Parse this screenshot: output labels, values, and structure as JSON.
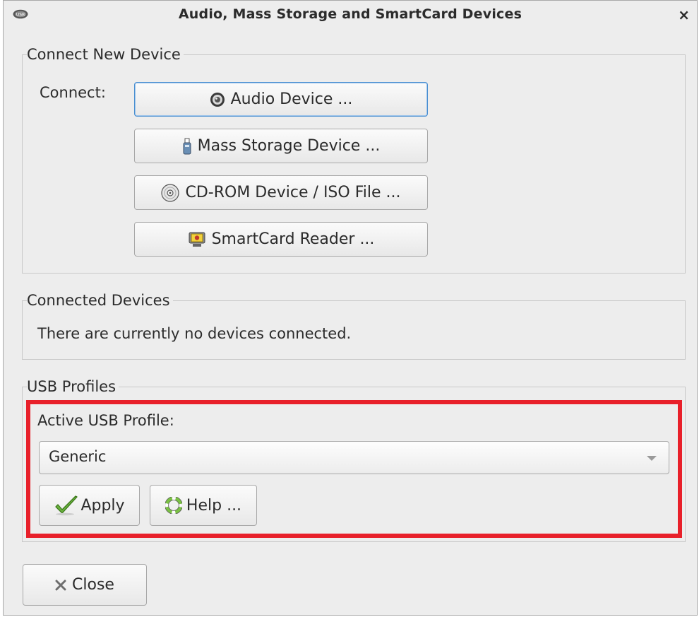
{
  "window": {
    "title": "Audio, Mass Storage and SmartCard Devices",
    "close_glyph": "×"
  },
  "connect_group": {
    "title": "Connect New Device",
    "connect_label": "Connect:",
    "buttons": [
      {
        "label": "Audio Device ...",
        "icon": "speaker-icon"
      },
      {
        "label": "Mass Storage Device ...",
        "icon": "usb-stick-icon"
      },
      {
        "label": "CD-ROM Device / ISO File ...",
        "icon": "cdrom-icon"
      },
      {
        "label": "SmartCard Reader ...",
        "icon": "smartcard-reader-icon"
      }
    ]
  },
  "connected_group": {
    "title": "Connected Devices",
    "empty_message": "There are currently no devices connected."
  },
  "usb_group": {
    "title": "USB Profiles",
    "active_label": "Active USB Profile:",
    "selected_profile": "Generic",
    "apply_label": "Apply",
    "help_label": "Help ..."
  },
  "footer": {
    "close_label": "Close"
  },
  "colors": {
    "highlight": "#e8202a",
    "focus": "#4a8fd1",
    "apply_check": "#6cb33f",
    "help_ring": "#7ac143"
  }
}
